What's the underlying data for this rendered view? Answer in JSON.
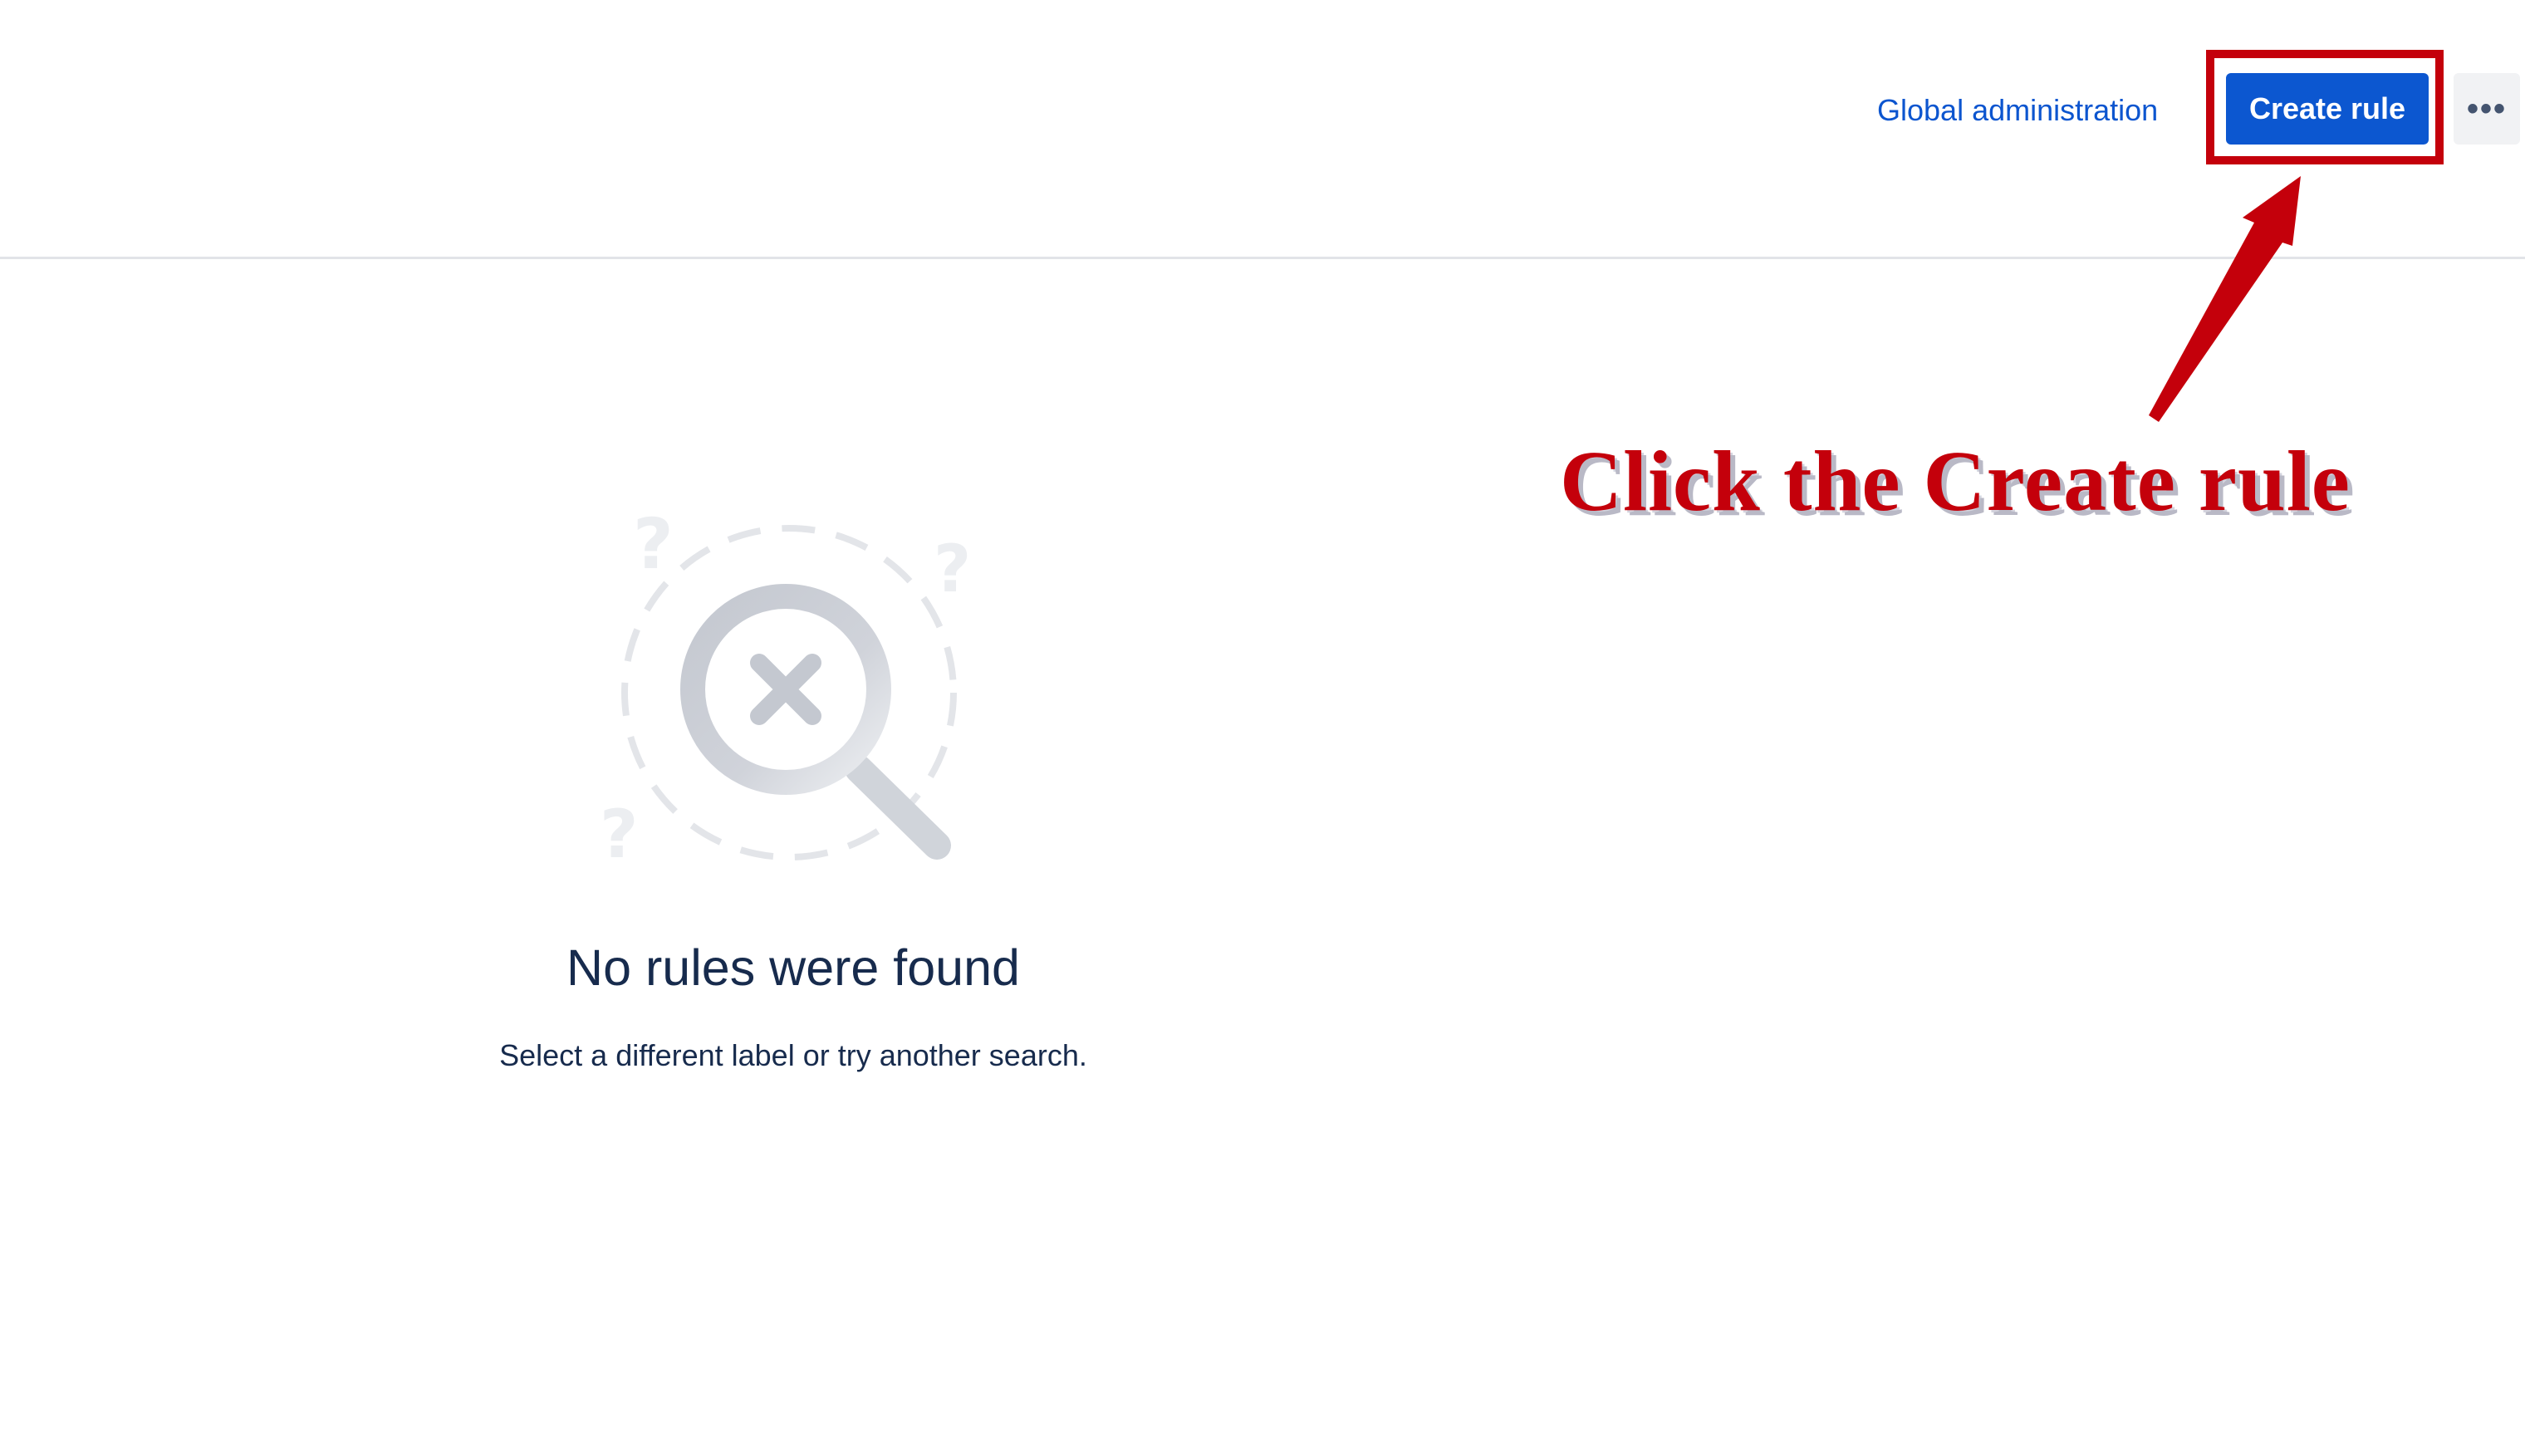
{
  "header": {
    "global_admin_label": "Global administration",
    "create_rule_label": "Create rule",
    "more_label": "•••"
  },
  "annotation": {
    "text": "Click the Create rule",
    "color": "#c4000b"
  },
  "empty_state": {
    "title": "No rules were found",
    "subtitle": "Select a different label or try another search.",
    "illustration_icon": "magnifier-x-icon"
  },
  "colors": {
    "primary_button": "#0c57d0",
    "link": "#0c55cf",
    "text": "#172b4d",
    "highlight": "#c4000b"
  }
}
